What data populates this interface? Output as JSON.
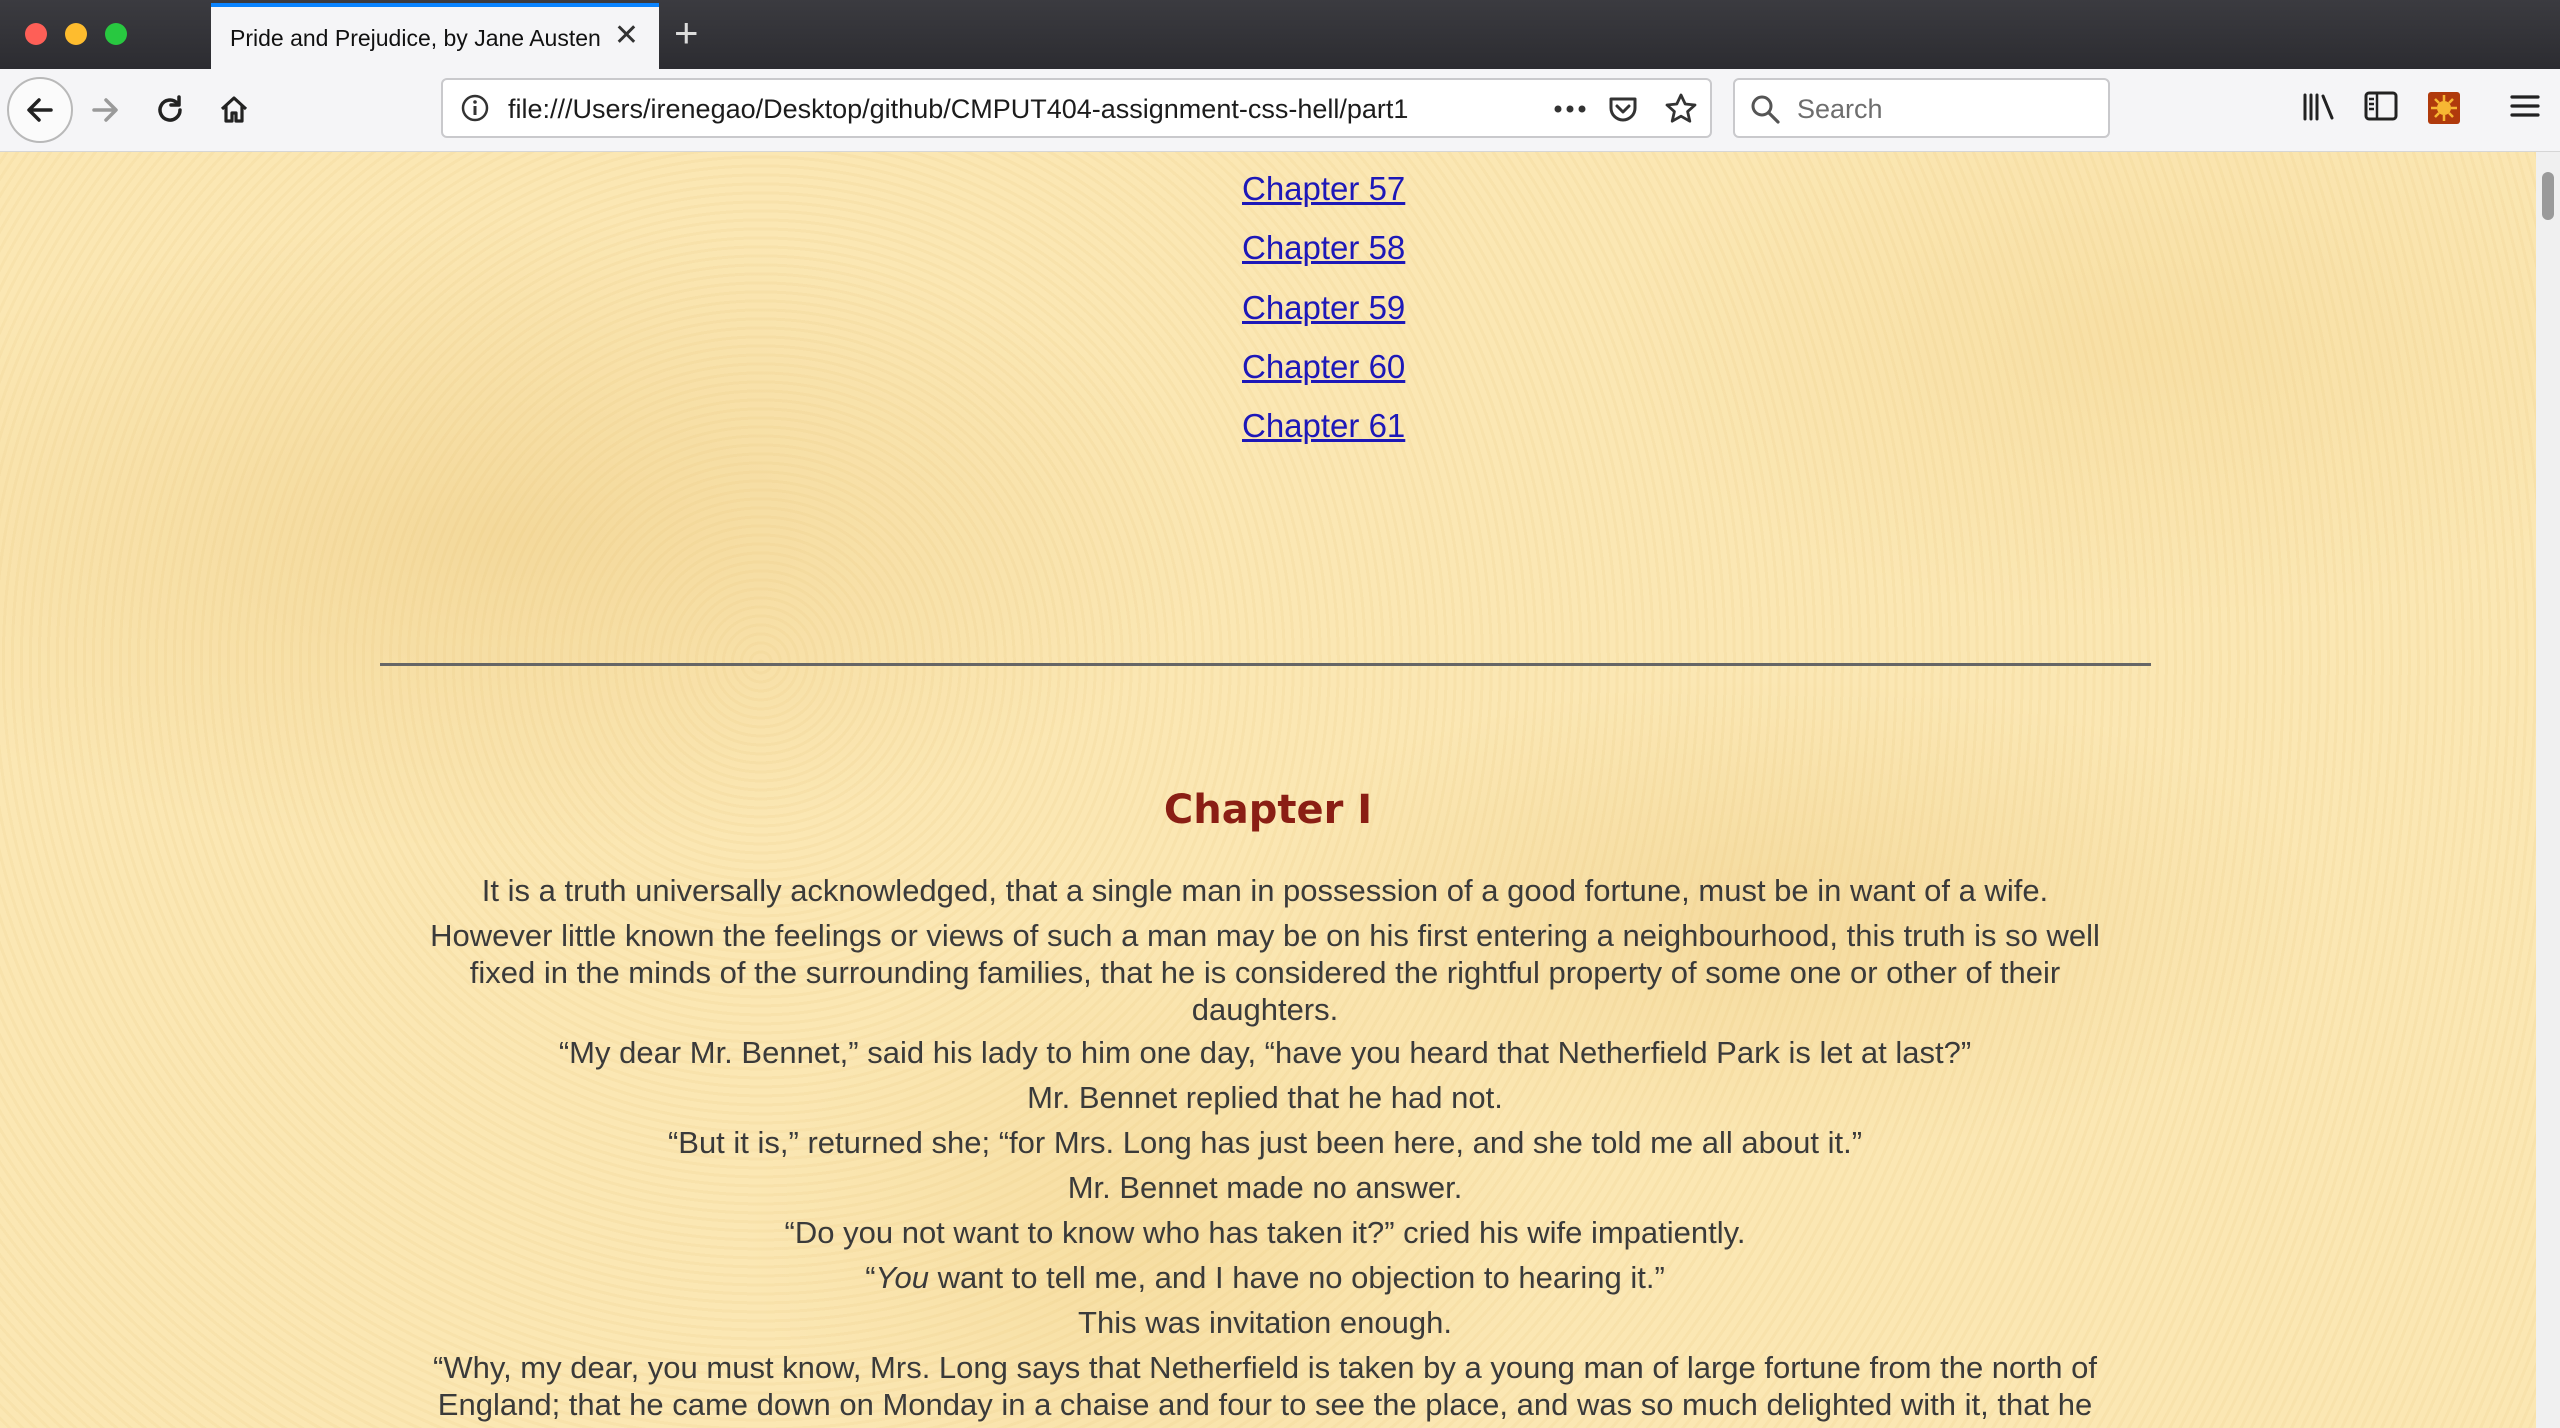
{
  "browser": {
    "tab_title": "Pride and Prejudice, by Jane Austen",
    "url": "file:///Users/irenegao/Desktop/github/CMPUT404-assignment-css-hell/part1",
    "search_placeholder": "Search"
  },
  "toc": {
    "chapters": [
      "Chapter 57",
      "Chapter 58",
      "Chapter 59",
      "Chapter 60",
      "Chapter 61"
    ]
  },
  "chapter": {
    "title": "Chapter I",
    "paragraphs": [
      "It is a truth universally acknowledged, that a single man in possession of a good fortune, must be in want of a wife.",
      "However little known the feelings or views of such a man may be on his first entering a neighbourhood, this truth is so well fixed in the minds of the surrounding families, that he is considered the rightful property of some one or other of their daughters.",
      "“My dear Mr. Bennet,” said his lady to him one day, “have you heard that Netherfield Park is let at last?”",
      "Mr. Bennet replied that he had not.",
      "“But it is,” returned she; “for Mrs. Long has just been here, and she told me all about it.”",
      "Mr. Bennet made no answer.",
      "“Do you not want to know who has taken it?” cried his wife impatiently.",
      "“",
      "You",
      " want to tell me, and I have no objection to hearing it.”",
      "This was invitation enough.",
      "“Why, my dear, you must know, Mrs. Long says that Netherfield is taken by a young man of large fortune from the north of England; that he came down on Monday in a chaise and four to see the place, and was so much delighted with it, that he"
    ]
  },
  "colors": {
    "link": "#1d18b8",
    "chapter_heading": "#8a1e14",
    "body_text": "#3a3a3a",
    "page_background": "#fbe7b3"
  }
}
